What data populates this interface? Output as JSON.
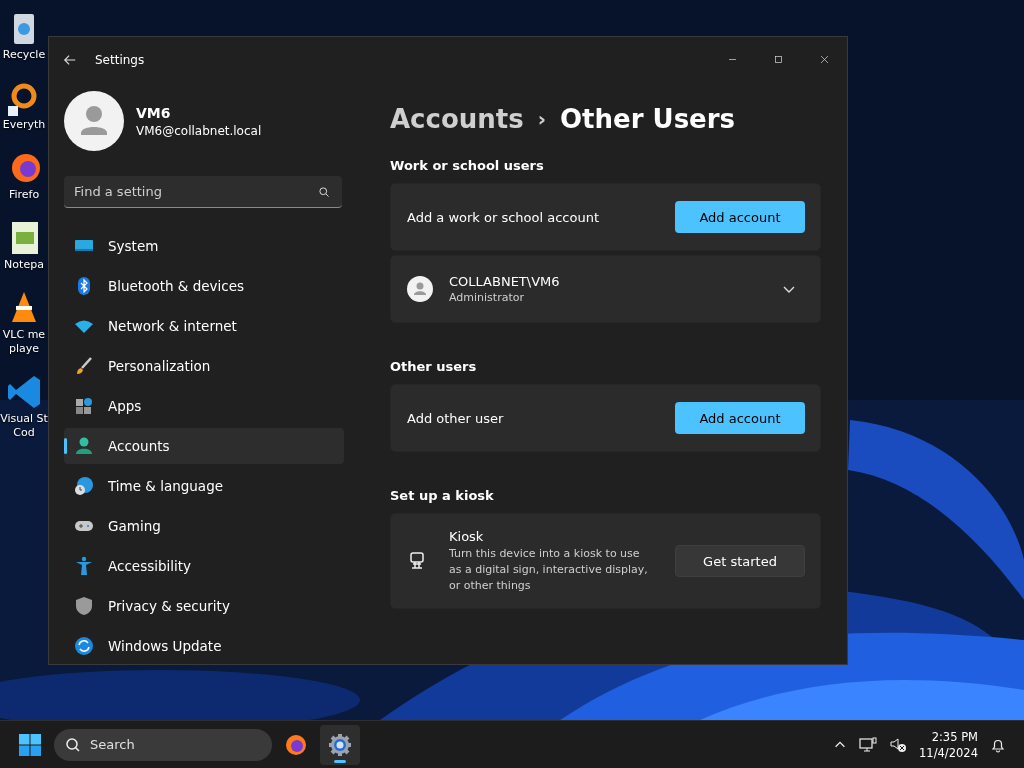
{
  "desktop_icons": [
    {
      "label_lines": [
        "Recycle"
      ]
    },
    {
      "label_lines": [
        "Everyth"
      ]
    },
    {
      "label_lines": [
        "Firefo"
      ]
    },
    {
      "label_lines": [
        "Notepa"
      ]
    },
    {
      "label_lines": [
        "VLC me",
        "playe"
      ]
    },
    {
      "label_lines": [
        "Visual St",
        "Cod"
      ]
    }
  ],
  "window": {
    "title": "Settings"
  },
  "account": {
    "name": "VM6",
    "email": "VM6@collabnet.local"
  },
  "search": {
    "placeholder": "Find a setting"
  },
  "nav": [
    {
      "label": "System",
      "selected": false
    },
    {
      "label": "Bluetooth & devices",
      "selected": false
    },
    {
      "label": "Network & internet",
      "selected": false
    },
    {
      "label": "Personalization",
      "selected": false
    },
    {
      "label": "Apps",
      "selected": false
    },
    {
      "label": "Accounts",
      "selected": true
    },
    {
      "label": "Time & language",
      "selected": false
    },
    {
      "label": "Gaming",
      "selected": false
    },
    {
      "label": "Accessibility",
      "selected": false
    },
    {
      "label": "Privacy & security",
      "selected": false
    },
    {
      "label": "Windows Update",
      "selected": false
    }
  ],
  "breadcrumb": {
    "parent": "Accounts",
    "separator": "›",
    "current": "Other Users"
  },
  "sections": [
    {
      "heading": "Work or school users",
      "cards": [
        {
          "kind": "action",
          "label": "Add a work or school account",
          "button": {
            "label": "Add account",
            "kind": "accent"
          }
        },
        {
          "kind": "user",
          "name": "COLLABNET\\VM6",
          "role": "Administrator",
          "expanded": false
        }
      ]
    },
    {
      "heading": "Other users",
      "cards": [
        {
          "kind": "action",
          "label": "Add other user",
          "button": {
            "label": "Add account",
            "kind": "accent"
          }
        }
      ]
    },
    {
      "heading": "Set up a kiosk",
      "cards": [
        {
          "kind": "kiosk",
          "title": "Kiosk",
          "description": "Turn this device into a kiosk to use as a digital sign, interactive display, or other things",
          "button": {
            "label": "Get started",
            "kind": "standard"
          }
        }
      ]
    }
  ],
  "taskbar": {
    "search_placeholder": "Search",
    "apps": [
      {
        "kind": "firefox",
        "active": false
      },
      {
        "kind": "settings",
        "active": true
      }
    ],
    "time": "2:35 PM",
    "date": "11/4/2024"
  }
}
